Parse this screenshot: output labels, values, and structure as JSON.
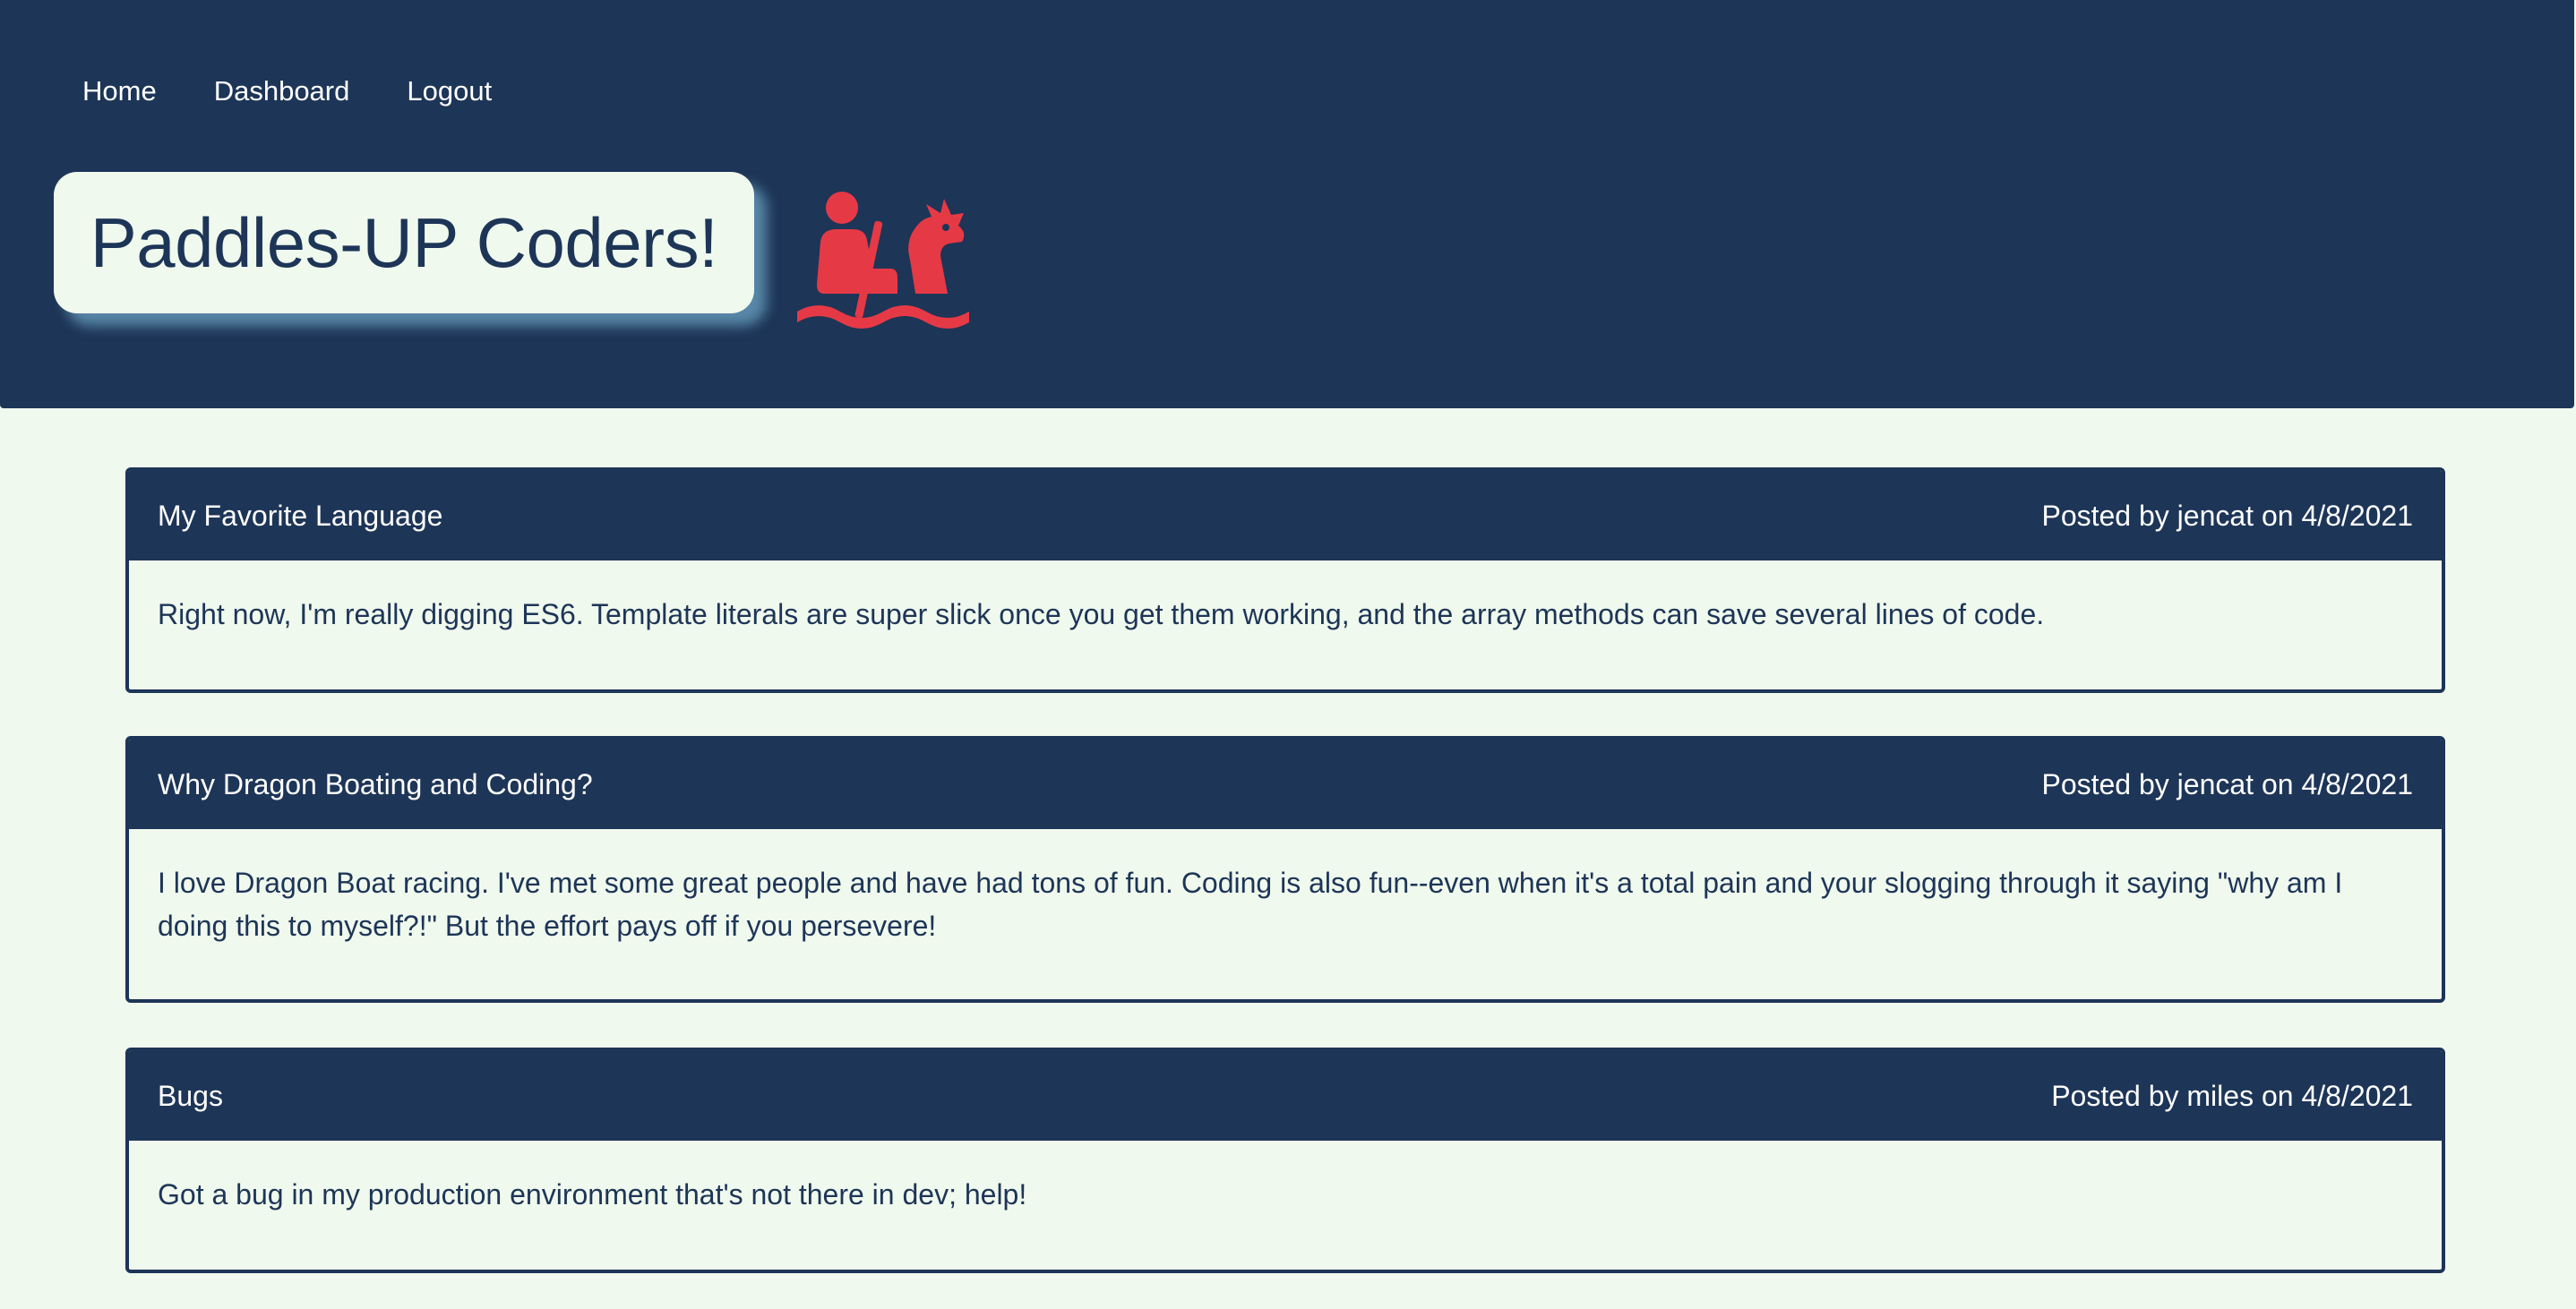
{
  "nav": {
    "items": [
      {
        "label": "Home"
      },
      {
        "label": "Dashboard"
      },
      {
        "label": "Logout"
      }
    ]
  },
  "site": {
    "title": "Paddles-UP Coders!",
    "logo_icon": "dragon-boat-paddler-icon"
  },
  "colors": {
    "primary": "#1d3557",
    "background": "#f0f9ed",
    "accent": "#e63946",
    "title_shadow": "#78b4d2"
  },
  "posts": [
    {
      "title": "My Favorite Language",
      "meta": "Posted by jencat on 4/8/2021",
      "body": "Right now, I'm really digging ES6. Template literals are super slick once you get them working, and the array methods can save several lines of code."
    },
    {
      "title": "Why Dragon Boating and Coding?",
      "meta": "Posted by jencat on 4/8/2021",
      "body": "I love Dragon Boat racing. I've met some great people and have had tons of fun. Coding is also fun--even when it's a total pain and your slogging through it saying \"why am I doing this to myself?!\" But the effort pays off if you persevere!"
    },
    {
      "title": "Bugs",
      "meta": "Posted by miles on 4/8/2021",
      "body": "Got a bug in my production environment that's not there in dev; help!"
    }
  ]
}
